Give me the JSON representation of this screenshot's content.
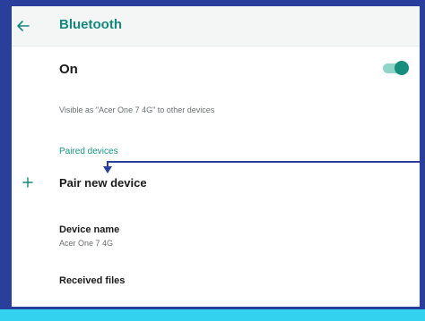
{
  "header": {
    "title": "Bluetooth",
    "back_icon": "arrow-left-icon"
  },
  "bluetooth": {
    "state_label": "On",
    "enabled": true,
    "visibility_text": "Visible as \"Acer One 7 4G\" to other devices"
  },
  "paired_devices": {
    "header": "Paired devices"
  },
  "pair_new": {
    "label": "Pair new device",
    "icon": "plus-icon"
  },
  "device_name": {
    "title": "Device name",
    "value": "Acer One 7 4G"
  },
  "received_files": {
    "label": "Received files"
  },
  "colors": {
    "accent": "#158a7c",
    "frame": "#2a3f9c",
    "strip": "#33d2ee",
    "pointer": "#2a3f9c"
  }
}
